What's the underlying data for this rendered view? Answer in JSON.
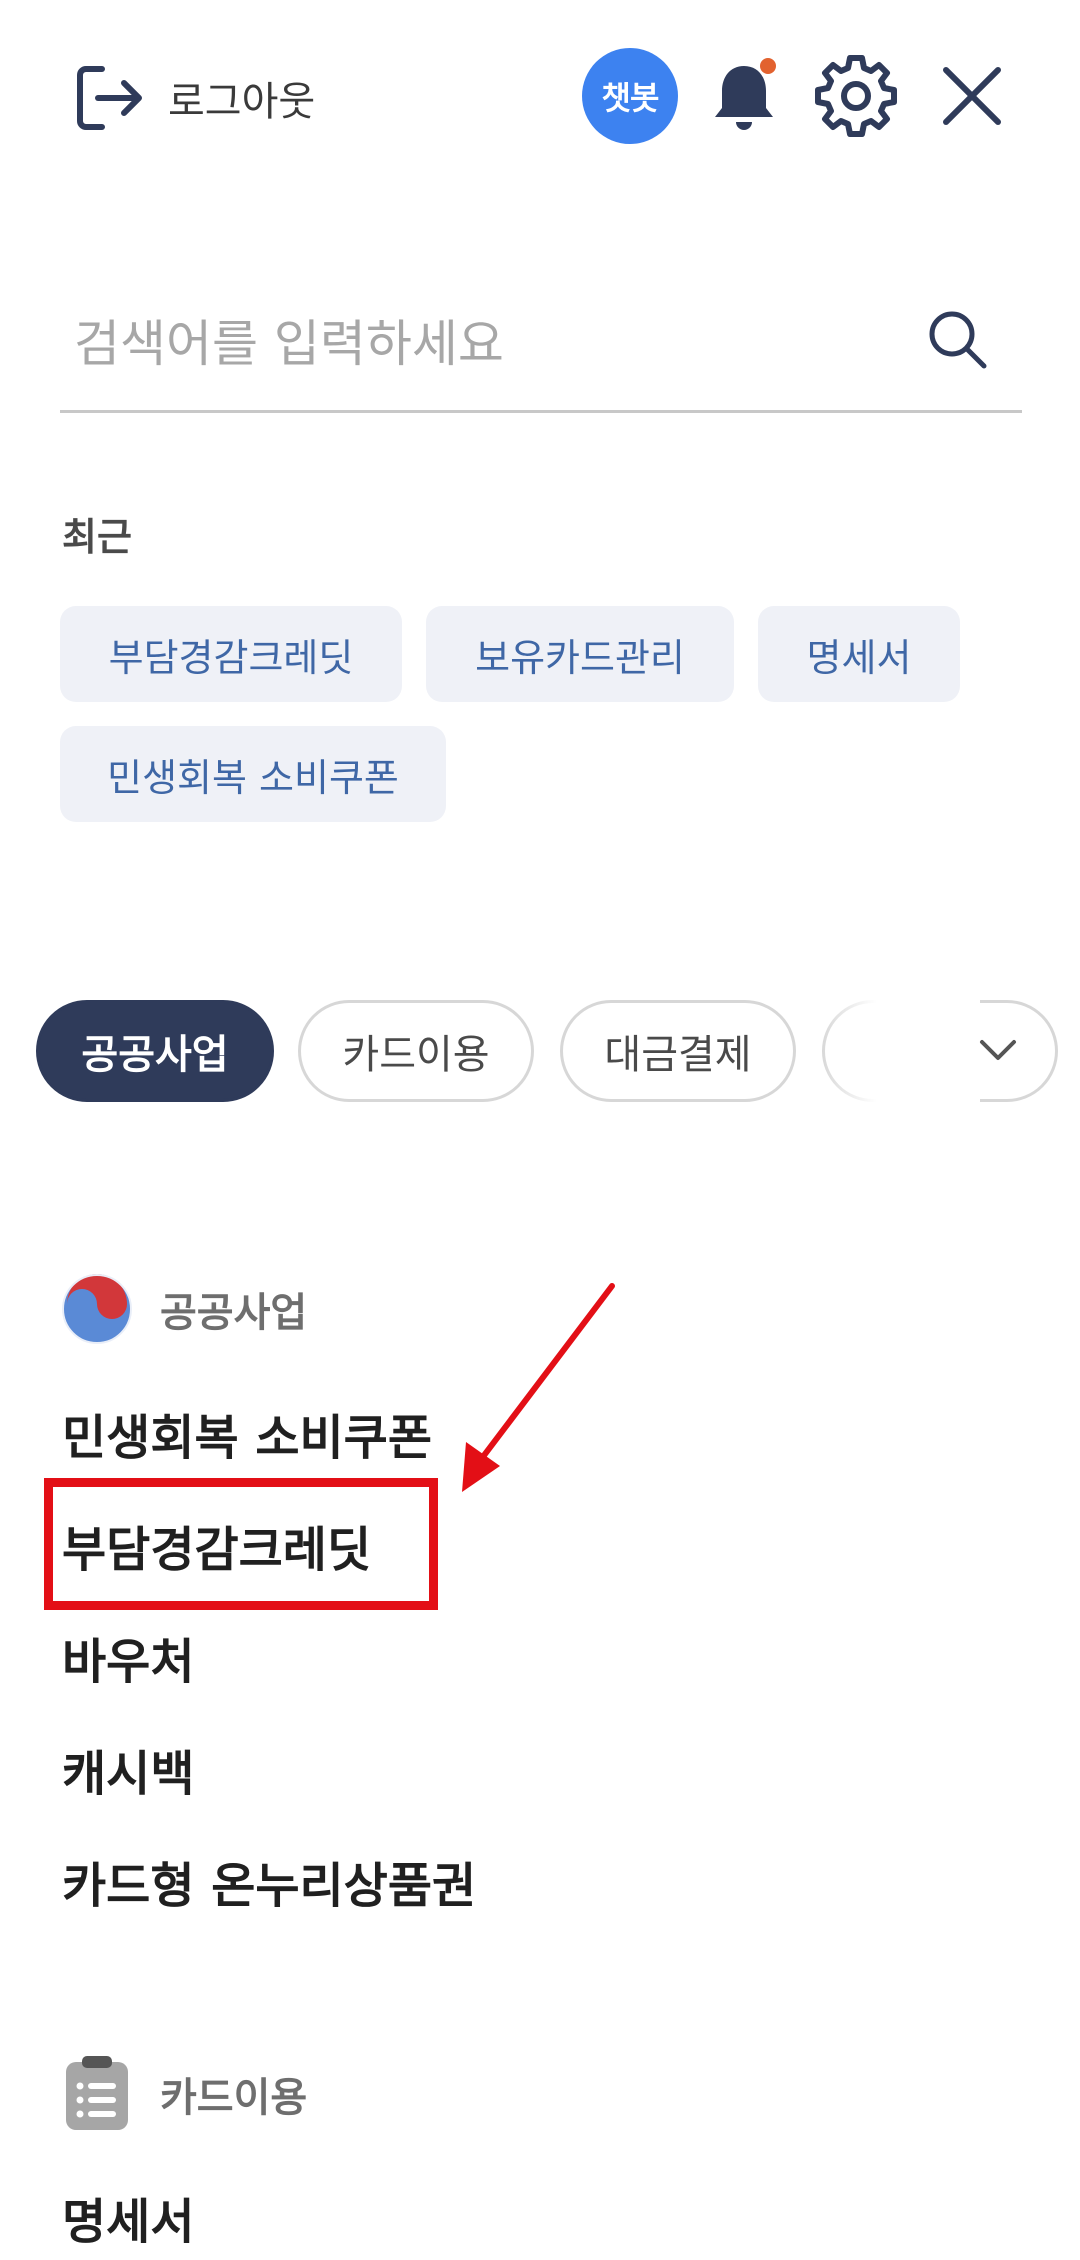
{
  "header": {
    "logout_label": "로그아웃",
    "chatbot_label": "챗봇",
    "icons": [
      "logout-icon",
      "bell-icon",
      "gear-icon",
      "close-icon"
    ]
  },
  "search": {
    "placeholder": "검색어를 입력하세요"
  },
  "recent": {
    "title": "최근",
    "items": [
      "부담경감크레딧",
      "보유카드관리",
      "명세서",
      "민생회복 소비쿠폰"
    ]
  },
  "categories": {
    "items": [
      "공공사업",
      "카드이용",
      "대금결제"
    ],
    "selected": "공공사업"
  },
  "sections": [
    {
      "title": "공공사업",
      "icon": "korea-emblem-icon",
      "items": [
        "민생회복 소비쿠폰",
        "부담경감크레딧",
        "바우처",
        "캐시백",
        "카드형 온누리상품권"
      ]
    },
    {
      "title": "카드이용",
      "icon": "clipboard-list-icon",
      "items": [
        "명세서"
      ]
    }
  ],
  "annotation": {
    "highlighted_item": "부담경감크레딧",
    "color": "#e30f16"
  },
  "colors": {
    "chatbot": "#3d82f0",
    "active_pill": "#2f3b5a",
    "chip_bg": "#eff1f7",
    "chip_text": "#3f67a6",
    "notification_dot": "#e2622f"
  }
}
